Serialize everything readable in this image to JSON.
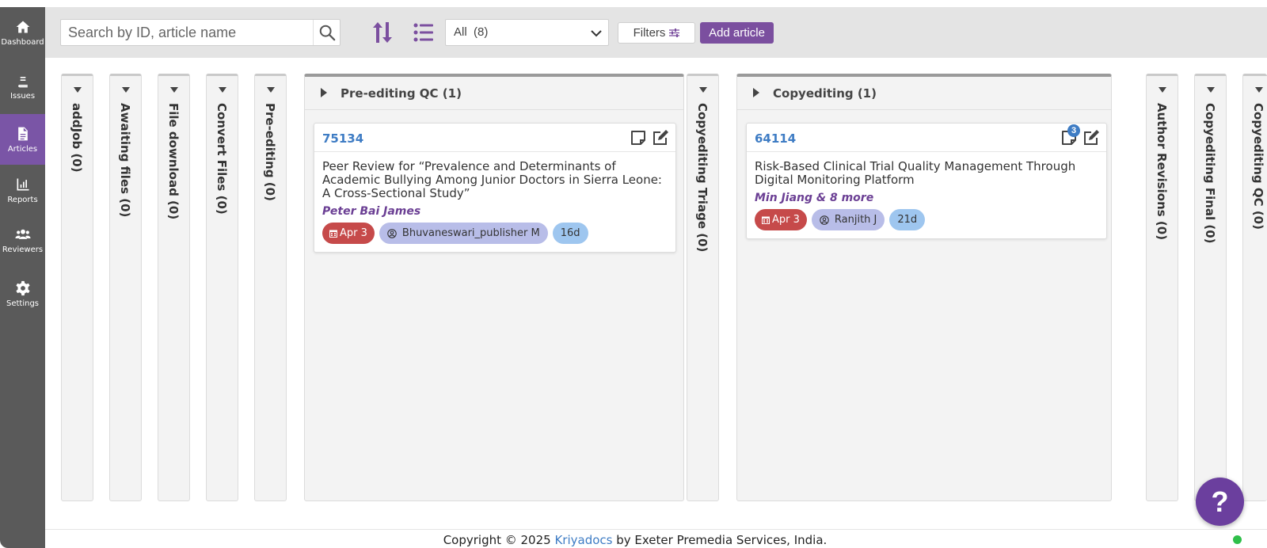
{
  "sidebar": {
    "items": [
      {
        "label": "Dashboard",
        "icon": "home-icon"
      },
      {
        "label": "Issues",
        "icon": "book-icon"
      },
      {
        "label": "Articles",
        "icon": "file-icon",
        "active": true
      },
      {
        "label": "Reports",
        "icon": "chart-icon"
      },
      {
        "label": "Reviewers",
        "icon": "users-icon"
      },
      {
        "label": "Settings",
        "icon": "gear-icon"
      }
    ]
  },
  "toolbar": {
    "search_placeholder": "Search by ID, article name",
    "view_select": "All  (8)",
    "filters_label": "Filters",
    "add_label": "Add article"
  },
  "columns": {
    "addjob": "addJob (0)",
    "awaiting": "Awaiting files (0)",
    "download": "File download (0)",
    "convert": "Convert Files (0)",
    "preediting": "Pre-editing (0)",
    "preqc": {
      "title": "Pre-editing QC (1)",
      "card": {
        "id": "75134",
        "title": "Peer Review for “Prevalence and Determinants of Academic Bullying Among Junior Doctors in Sierra Leone: A Cross-Sectional Study”",
        "author": "Peter Bai James",
        "date": "Apr 3",
        "user": "Bhuvaneswari_publisher M",
        "days": "16d"
      }
    },
    "triage": "Copyediting Triage (0)",
    "copyediting": {
      "title": "Copyediting (1)",
      "card": {
        "id": "64114",
        "title": "Risk-Based Clinical Trial Quality Management Through Digital Monitoring Platform",
        "author": "Min Jiang & 8 more",
        "date": "Apr 3",
        "user": "Ranjith J",
        "days": "21d",
        "notes_count": "3"
      }
    },
    "author_revisions": "Author Revisions (0)",
    "copyediting_final": "Copyediting Final (0)",
    "copyediting_qc": "Copyediting QC (0)"
  },
  "footer": {
    "prefix": "Copyright © 2025 ",
    "brand": "Kriyadocs",
    "suffix": " by Exeter Premedia Services, India."
  },
  "help_label": "?",
  "colors": {
    "accent": "#7b4f9f",
    "link": "#3e7cc4",
    "date_tag": "#c64a4a",
    "user_tag": "#b8bde8",
    "days_tag": "#9ec6ef"
  }
}
